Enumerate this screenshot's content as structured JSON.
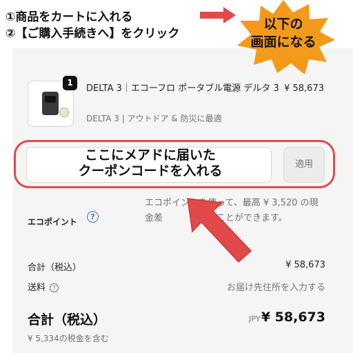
{
  "annotations": {
    "step1": "①商品をカートに入れる",
    "step2": "②【ご購入手続きへ】をクリック",
    "burst_line1": "以下の",
    "burst_line2": "画面になる",
    "coupon_line1": "ここにメアドに届いた",
    "coupon_line2": "クーポンコードを入れる"
  },
  "product": {
    "quantity": "1",
    "title": "DELTA 3｜エコーフロ ポータブル電源 デルタ 3",
    "subtitle": "DELTA 3 | アウトドア & 防災に最適",
    "price": "¥ 58,673",
    "image_icon": "portable-power-station-icon"
  },
  "coupon": {
    "apply_label": "適用"
  },
  "ecopoint": {
    "label": "エコポイント",
    "description": "エコポイントを使って、最高 ¥ 3,520 の現金差　　　をすることができます。"
  },
  "summary": {
    "subtotal_label": "合計（税込）",
    "subtotal_value": "¥ 58,673",
    "shipping_label": "送料",
    "shipping_value": "お届け先住所を入力する",
    "total_label": "合計（税込）",
    "currency": "JPY",
    "total_value": "¥ 58,673",
    "tax_note": "¥ 5,334の税金を含む"
  },
  "colors": {
    "accent_red": "#e24a4a",
    "burst_orange": "#f39a1a",
    "help_blue": "#3d6fd8",
    "panel_bg": "#f5f5f5"
  }
}
